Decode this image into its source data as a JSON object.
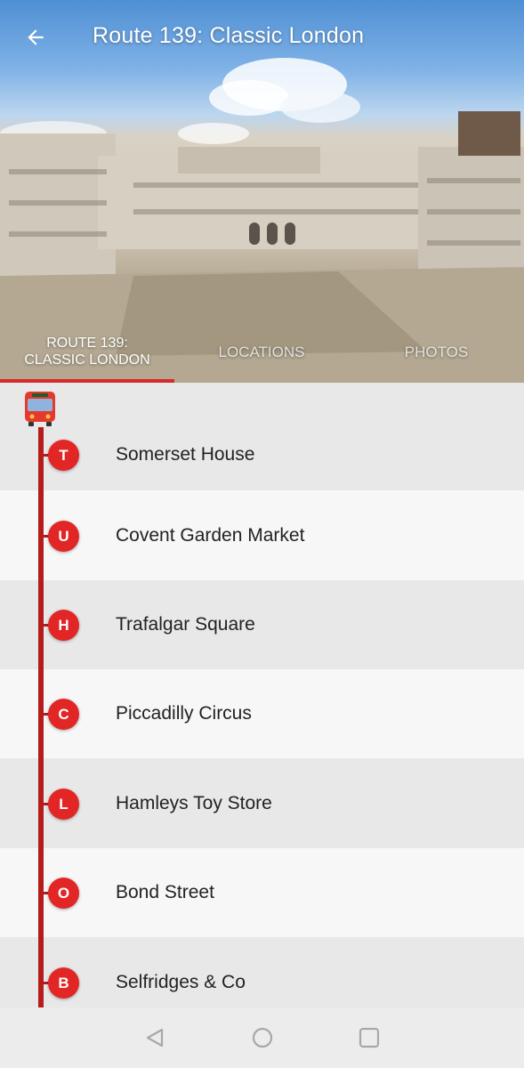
{
  "header": {
    "title": "Route 139: Classic London",
    "tabs": [
      {
        "label_line1": "ROUTE 139:",
        "label_line2": "CLASSIC LONDON",
        "active": true
      },
      {
        "label": "LOCATIONS",
        "active": false
      },
      {
        "label": "PHOTOS",
        "active": false
      }
    ]
  },
  "stops": [
    {
      "letter": "T",
      "name": "Somerset House"
    },
    {
      "letter": "U",
      "name": "Covent Garden Market"
    },
    {
      "letter": "H",
      "name": "Trafalgar Square"
    },
    {
      "letter": "C",
      "name": "Piccadilly Circus"
    },
    {
      "letter": "L",
      "name": "Hamleys Toy Store"
    },
    {
      "letter": "O",
      "name": "Bond Street"
    },
    {
      "letter": "B",
      "name": "Selfridges & Co"
    }
  ],
  "icons": {
    "back": "arrow-back-icon",
    "route": "bus-icon",
    "nav": [
      "back-triangle-icon",
      "home-circle-icon",
      "recents-square-icon"
    ]
  },
  "colors": {
    "accent": "#e22626",
    "route_line": "#b51c1c"
  }
}
